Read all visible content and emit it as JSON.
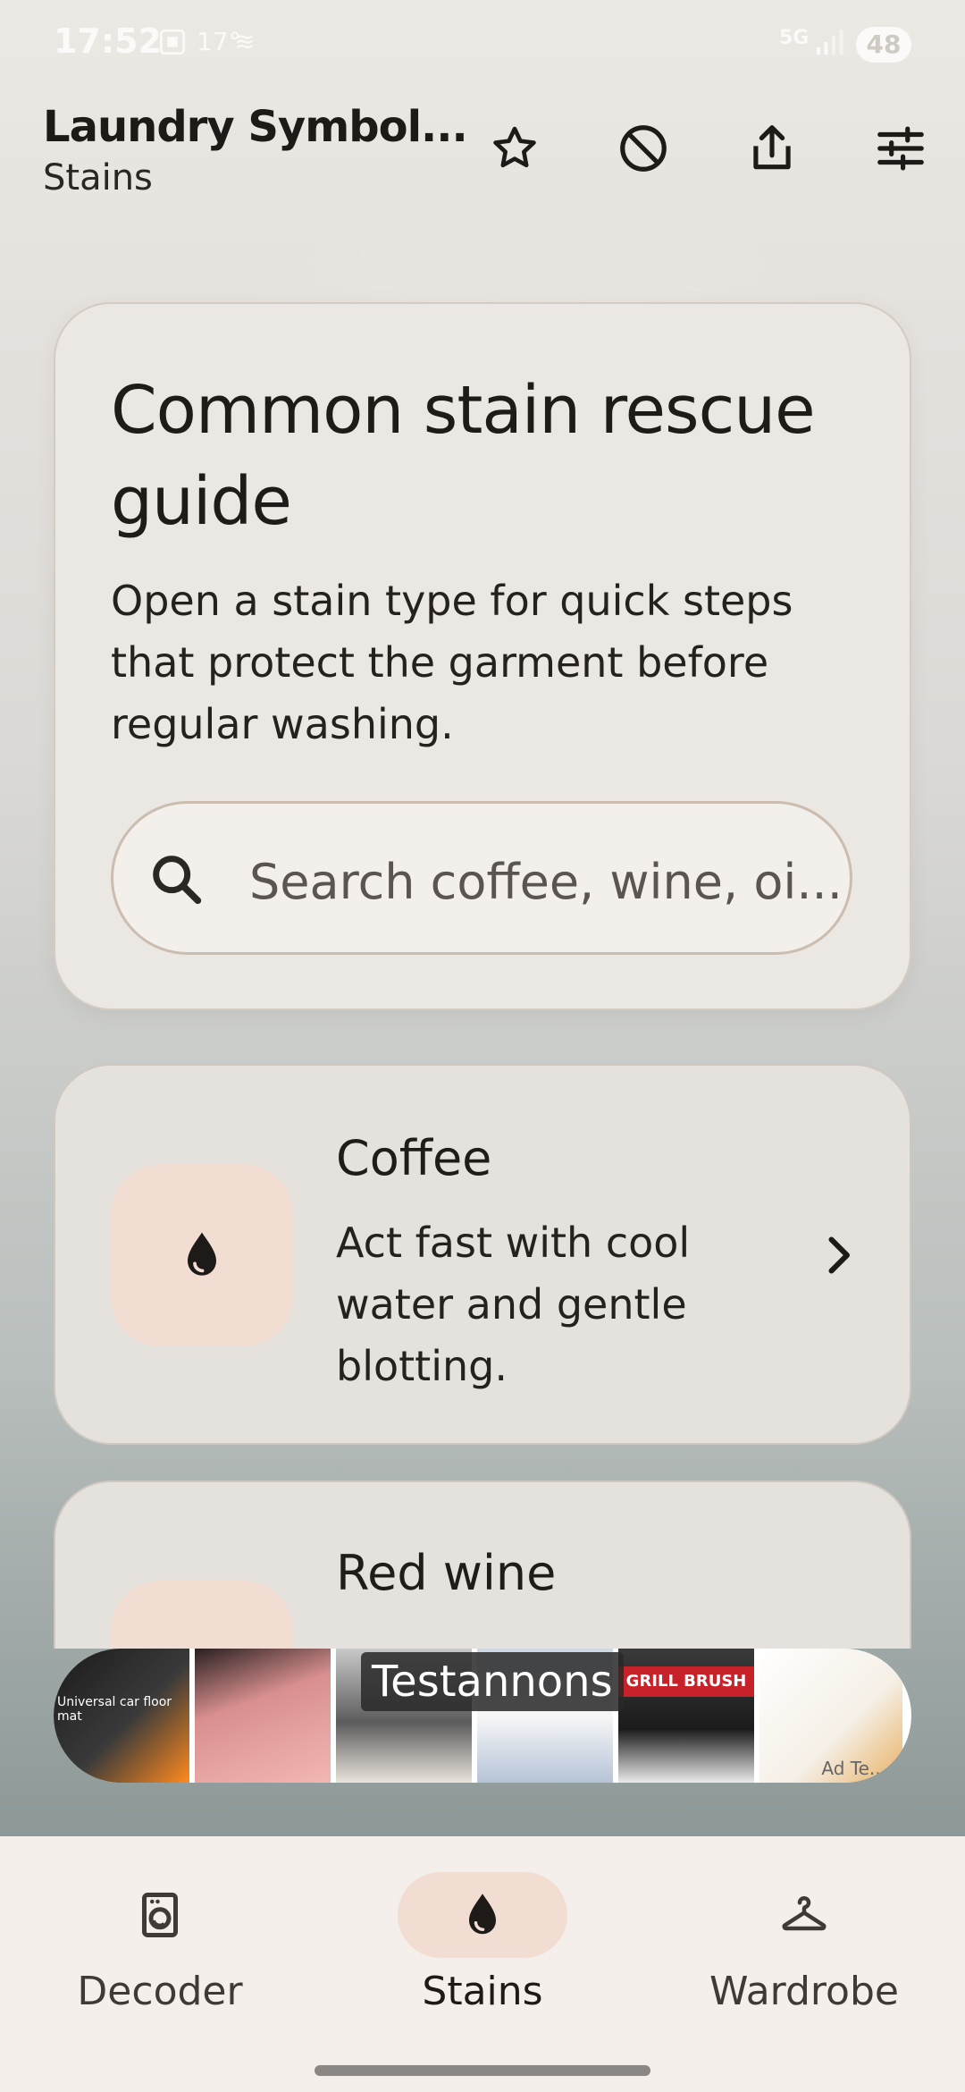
{
  "status_bar": {
    "time": "17:52",
    "temperature": "17°",
    "network": "5G",
    "battery": "48"
  },
  "top_bar": {
    "title": "Laundry Symbol...",
    "subtitle": "Stains",
    "actions": [
      "star-icon",
      "do-not-disturb-icon",
      "share-icon",
      "tune-icon"
    ]
  },
  "hero": {
    "heading": "Common stain rescue guide",
    "description": "Open a stain type for quick steps that protect the garment before regular washing.",
    "search_placeholder": "Search coffee, wine, oi..."
  },
  "stains": [
    {
      "title": "Coffee",
      "description": "Act fast with cool water and gentle blotting.",
      "icon": "drop-icon"
    },
    {
      "title": "Red wine",
      "description": "",
      "icon": "drop-icon"
    }
  ],
  "ad": {
    "label": "Testannons",
    "tile1_caption": "Universal car floor mat",
    "tile5_banner": "GRILL BRUSH",
    "tile6_caption": "Ad Te..."
  },
  "bottom_nav": {
    "items": [
      {
        "label": "Decoder",
        "icon": "washing-machine-icon",
        "active": false
      },
      {
        "label": "Stains",
        "icon": "drop-icon",
        "active": true
      },
      {
        "label": "Wardrobe",
        "icon": "hanger-icon",
        "active": false
      }
    ]
  },
  "colors": {
    "accent_container": "#f1ddd2",
    "card_surface": "#ebe7e2",
    "text_primary": "#1e1b19"
  }
}
